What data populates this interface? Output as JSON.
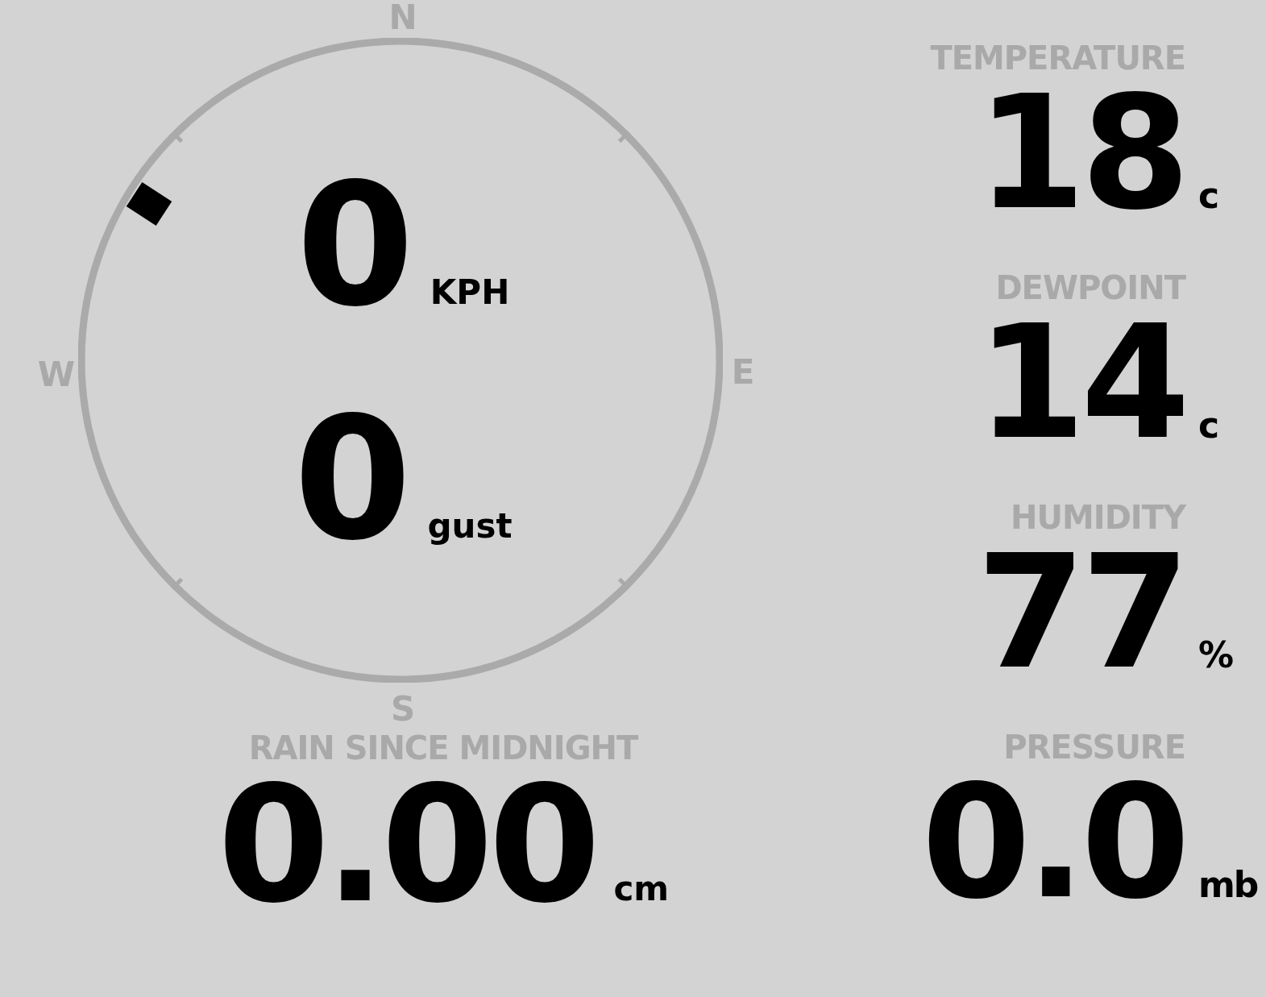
{
  "compass": {
    "north": "N",
    "east": "E",
    "south": "S",
    "west": "W"
  },
  "wind": [
    {
      "value": "0",
      "unit": "KPH"
    },
    {
      "value": "0",
      "unit": "gust"
    }
  ],
  "rain": {
    "label": "RAIN SINCE MIDNIGHT",
    "value": "0.00",
    "unit": "cm"
  },
  "readings": [
    {
      "label": "TEMPERATURE",
      "value": "18",
      "unit": "c"
    },
    {
      "label": "DEWPOINT",
      "value": "14",
      "unit": "c"
    },
    {
      "label": "HUMIDITY",
      "value": "77",
      "unit": "%"
    },
    {
      "label": "PRESSURE",
      "value": "0.0",
      "unit": "mb"
    }
  ]
}
